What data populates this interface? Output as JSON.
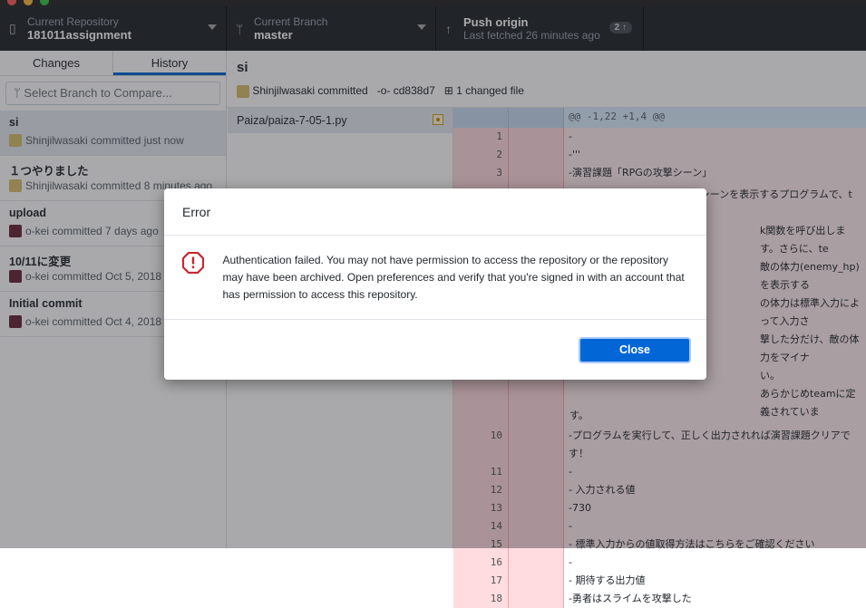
{
  "toolbar": {
    "repository": {
      "label": "Current Repository",
      "value": "181011assignment"
    },
    "branch": {
      "label": "Current Branch",
      "value": "master"
    },
    "push": {
      "label": "Push origin",
      "sub": "Last fetched 26 minutes ago",
      "badge": "2 ↑"
    }
  },
  "sidebar": {
    "tabs": [
      "Changes",
      "History"
    ],
    "compare_placeholder": "Select Branch to Compare...",
    "commits": [
      {
        "summary": "si",
        "meta": "Shinjilwasaki committed just now"
      },
      {
        "summary": "１つやりました",
        "meta": "Shinjilwasaki committed 8 minutes ago"
      },
      {
        "summary": "upload",
        "meta": "o-kei committed 7 days ago"
      },
      {
        "summary": "10/11に変更",
        "meta": "o-kei committed Oct 5, 2018"
      },
      {
        "summary": "Initial commit",
        "meta": "o-kei committed Oct 4, 2018"
      }
    ]
  },
  "commit": {
    "title": "si",
    "author": "Shinjilwasaki committed",
    "sha": "cd838d7",
    "files_changed": "1 changed file"
  },
  "files": [
    {
      "path": "Paiza/paiza-7-05-1.py",
      "status": "modified"
    }
  ],
  "diff": {
    "hunk": "@@ -1,22 +1,4 @@",
    "lines_top": [
      {
        "n": "1",
        "t": "-"
      },
      {
        "n": "2",
        "t": "-'''"
      },
      {
        "n": "3",
        "t": "-演習課題「RPGの攻撃シーン」"
      }
    ],
    "fragments": [
      "右のコードには、RPGの攻撃シーンを表示するプログラムで、t",
      "k関数を呼び出します。さらに、te",
      "敵の体力(enemy_hp)を表示する",
      "の体力は標準入力によって入力さ",
      "撃した分だけ、敵の体力をマイナ",
      "い。",
      "あらかじめteamに定義されていま",
      "す。"
    ],
    "lines_bottom": [
      {
        "n": "10",
        "t": "-プログラムを実行して、正しく出力されれば演習課題クリアです！"
      },
      {
        "n": "11",
        "t": "-"
      },
      {
        "n": "12",
        "t": "- 入力される値"
      },
      {
        "n": "13",
        "t": "-730"
      },
      {
        "n": "14",
        "t": "-"
      },
      {
        "n": "15",
        "t": "- 標準入力からの値取得方法はこちらをご確認ください"
      },
      {
        "n": "16",
        "t": "-"
      },
      {
        "n": "17",
        "t": "- 期待する出力値"
      },
      {
        "n": "18",
        "t": "-勇者はスライムを攻撃した"
      }
    ]
  },
  "dialog": {
    "title": "Error",
    "message": "Authentication failed. You may not have permission to access the repository or the repository may have been archived. Open preferences and verify that you're signed in with an account that has permission to access this repository.",
    "close_label": "Close",
    "icon": "alert-octagon-icon"
  },
  "colors": {
    "accent": "#0366d6",
    "error": "#cb2431",
    "diff_removed": "#ffdce0"
  }
}
